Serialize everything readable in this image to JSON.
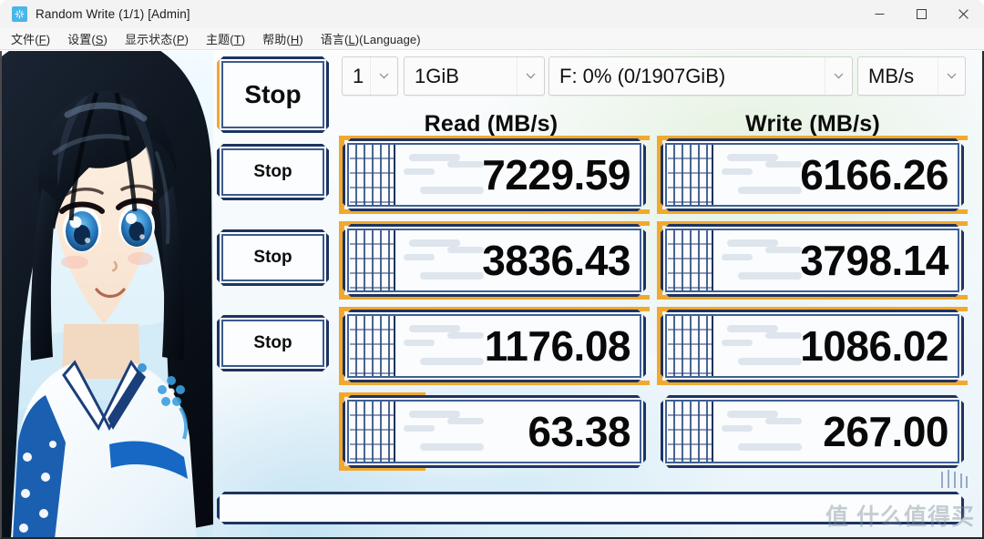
{
  "window": {
    "title": "Random Write (1/1) [Admin]",
    "app_icon": "pinwheel-icon",
    "controls": {
      "minimize": "minimize-icon",
      "maximize": "maximize-icon",
      "close": "close-icon"
    }
  },
  "menu": {
    "items": [
      {
        "label": "文件(F)",
        "pre": "文件(",
        "accel": "F",
        "post": ")"
      },
      {
        "label": "设置(S)",
        "pre": "设置(",
        "accel": "S",
        "post": ")"
      },
      {
        "label": "显示状态(P)",
        "pre": "显示状态(",
        "accel": "P",
        "post": ")"
      },
      {
        "label": "主题(T)",
        "pre": "主题(",
        "accel": "T",
        "post": ")"
      },
      {
        "label": "帮助(H)",
        "pre": "帮助(",
        "accel": "H",
        "post": ")"
      },
      {
        "label": "语言(L)(Language)",
        "pre": "语言(",
        "accel": "L",
        "post": ")(Language)"
      }
    ]
  },
  "toolbar": {
    "count": {
      "value": "1",
      "arrow": "chevron-down-icon"
    },
    "size": {
      "value": "1GiB",
      "arrow": "chevron-down-icon"
    },
    "drive": {
      "value": "F: 0% (0/1907GiB)",
      "arrow": "chevron-down-icon"
    },
    "unit": {
      "value": "MB/s",
      "arrow": "chevron-down-icon"
    }
  },
  "headers": {
    "read": "Read (MB/s)",
    "write": "Write (MB/s)"
  },
  "colors": {
    "frame_navy": "#1d3461",
    "progress_orange": "#f2a82e",
    "icon_cyan": "#4ab6e8",
    "value_black": "#090909"
  },
  "rows": [
    {
      "button": "Stop",
      "read": "7229.59",
      "write": "6166.26",
      "read_progress": 100,
      "write_progress": 100
    },
    {
      "button": "Stop",
      "read": "3836.43",
      "write": "3798.14",
      "read_progress": 100,
      "write_progress": 100
    },
    {
      "button": "Stop",
      "read": "1176.08",
      "write": "1086.02",
      "read_progress": 100,
      "write_progress": 100
    },
    {
      "button": "Stop",
      "read": "63.38",
      "write": "267.00",
      "read_progress": 28,
      "write_progress": 0
    }
  ],
  "bottom_progress": {
    "percent": 0
  },
  "watermark": {
    "text": "值 什么值得买"
  }
}
